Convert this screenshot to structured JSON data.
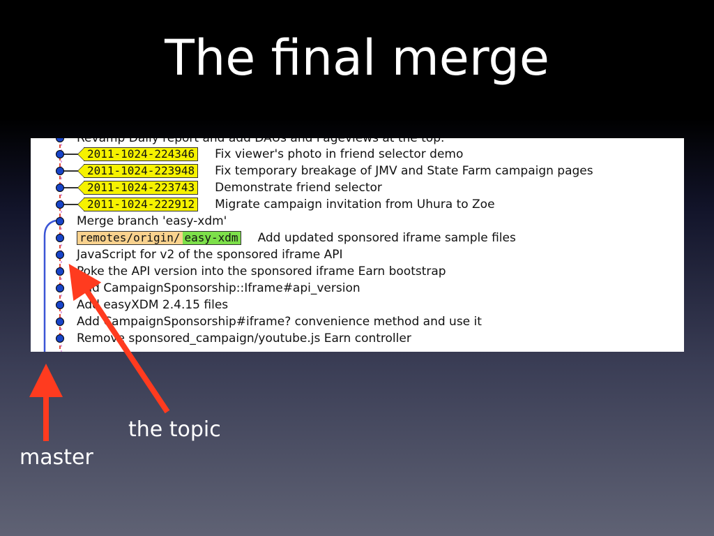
{
  "slide": {
    "title": "The final merge",
    "label_topic": "the topic",
    "label_master": "master"
  },
  "colors": {
    "arrow": "#ff3b1f",
    "master_line": "#3b55d6",
    "topic_line": "#e14a3b",
    "node": "#1844c8",
    "tag_yellow": "#f6f200",
    "remote_orange": "#f9d28e",
    "remote_green": "#7de04a"
  },
  "log": {
    "cut_top": "Revamp Daily report and add DAUs and Pageviews at the top.",
    "commits": [
      {
        "tag": "2011-1024-224346",
        "message": "Fix viewer's photo in friend selector demo"
      },
      {
        "tag": "2011-1024-223948",
        "message": "Fix temporary breakage of JMV and State Farm campaign pages"
      },
      {
        "tag": "2011-1024-223743",
        "message": "Demonstrate friend selector"
      },
      {
        "tag": "2011-1024-222912",
        "message": "Migrate campaign invitation from Uhura to Zoe"
      },
      {
        "message": "Merge branch 'easy-xdm'"
      },
      {
        "remote_prefix": "remotes/origin/",
        "remote_branch": "easy-xdm",
        "message": "Add updated sponsored iframe sample files"
      },
      {
        "message": "JavaScript for v2 of the sponsored iframe API"
      },
      {
        "message": "Poke the API version into the sponsored iframe Earn bootstrap"
      },
      {
        "message": "Add CampaignSponsorship::Iframe#api_version"
      },
      {
        "message": "Add easyXDM 2.4.15 files"
      },
      {
        "message": "Add CampaignSponsorship#iframe? convenience method and use it"
      },
      {
        "message": "Remove sponsored_campaign/youtube.js Earn controller"
      }
    ]
  }
}
